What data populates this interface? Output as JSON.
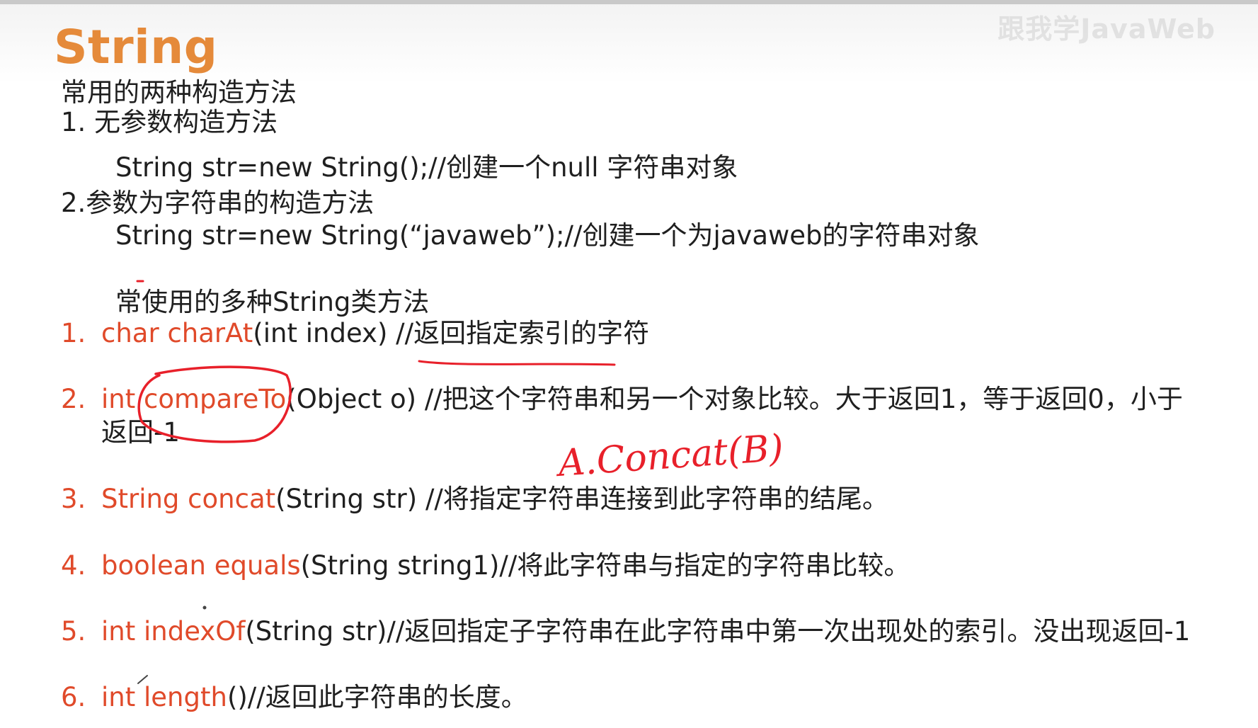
{
  "slide": {
    "title": "String",
    "watermark": "跟我学JavaWeb",
    "intro": {
      "heading": "常用的两种构造方法",
      "first_label": "1. 无参数构造方法",
      "first_code": "String str=new String();//创建一个null 字符串对象",
      "second_label": "2.参数为字符串的构造方法",
      "second_code": "String str=new String(“javaweb”);//创建一个为javaweb的字符串对象",
      "methods_heading": "常使用的多种String类方法"
    },
    "methods": [
      {
        "num": "1.",
        "sig": "char charAt",
        "rest": "(int index)  //返回指定索引的字符"
      },
      {
        "num": "2.",
        "sig": "int compareTo",
        "rest": "(Object o) //把这个字符串和另一个对象比较。大于返回1，等于返回0，小于",
        "cont": "返回-1"
      },
      {
        "num": "3.",
        "sig": "String concat",
        "rest": "(String str)  //将指定字符串连接到此字符串的结尾。"
      },
      {
        "num": "4.",
        "sig": "boolean equals",
        "rest": "(String string1)//将此字符串与指定的字符串比较。"
      },
      {
        "num": "5.",
        "sig": "int indexOf",
        "rest": "(String str)//返回指定子字符串在此字符串中第一次出现处的索引。没出现返回-1"
      },
      {
        "num": "6.",
        "sig": "int length",
        "rest": "()//返回此字符串的长度。"
      }
    ],
    "annotation": "A.Concat(B)",
    "colors": {
      "title": "#e58a3a",
      "keyword": "#e04a2a",
      "ink": "#e8202a"
    }
  }
}
